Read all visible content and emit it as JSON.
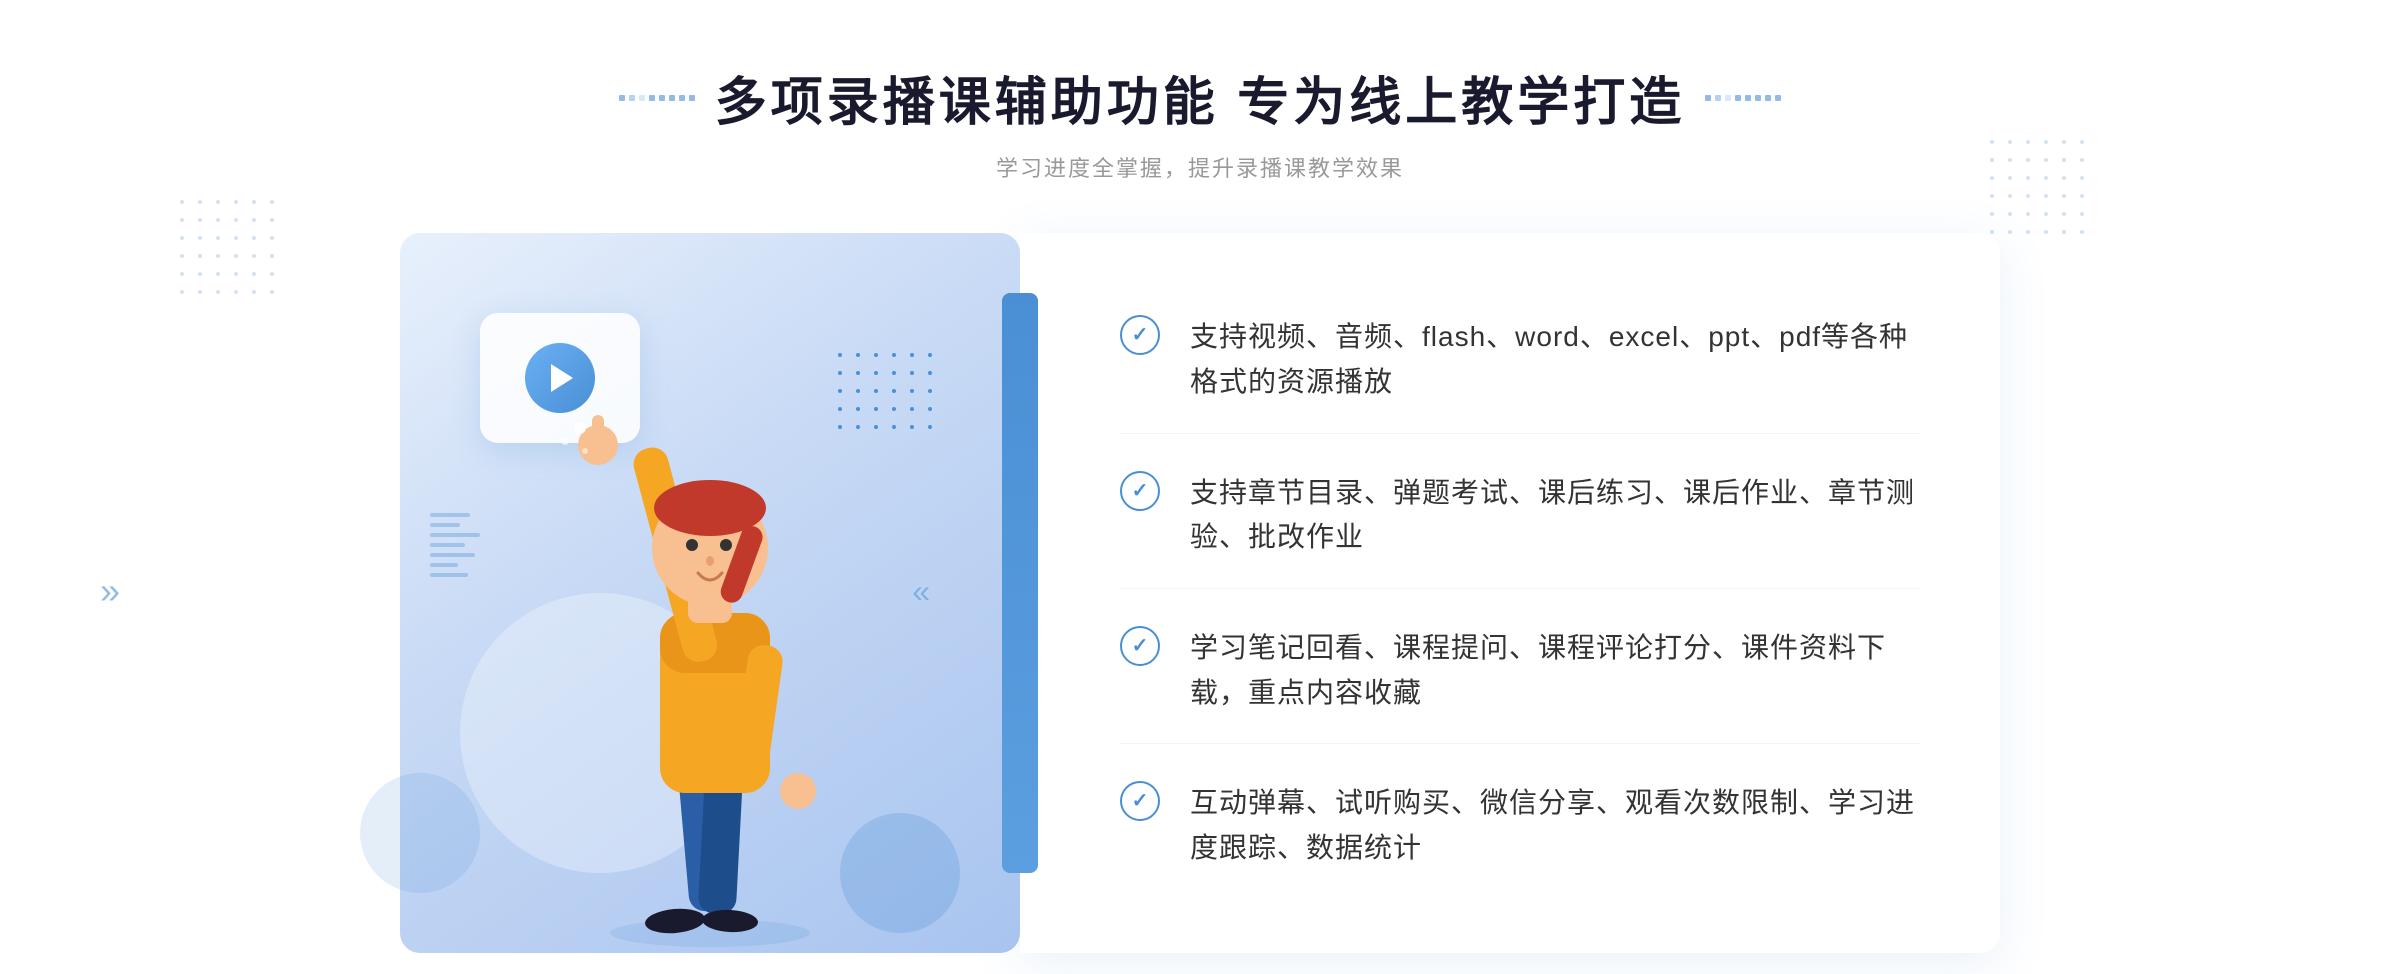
{
  "header": {
    "title": "多项录播课辅助功能 专为线上教学打造",
    "subtitle": "学习进度全掌握，提升录播课教学效果"
  },
  "features": [
    {
      "id": "feature-1",
      "text": "支持视频、音频、flash、word、excel、ppt、pdf等各种格式的资源播放"
    },
    {
      "id": "feature-2",
      "text": "支持章节目录、弹题考试、课后练习、课后作业、章节测验、批改作业"
    },
    {
      "id": "feature-3",
      "text": "学习笔记回看、课程提问、课程评论打分、课件资料下载，重点内容收藏"
    },
    {
      "id": "feature-4",
      "text": "互动弹幕、试听购买、微信分享、观看次数限制、学习进度跟踪、数据统计"
    }
  ],
  "decorations": {
    "arrow_label": "»",
    "check_symbol": "✓"
  }
}
